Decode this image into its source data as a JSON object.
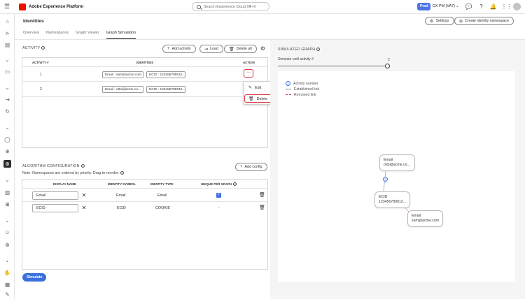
{
  "topbar": {
    "app_title": "Adobe Experience Platform",
    "search_placeholder": "Search Experience Cloud (⌘+/)",
    "org_badge": "Prod",
    "org_name": "DX PM (VA7)"
  },
  "header": {
    "title": "Identities",
    "settings_label": "Settings",
    "create_label": "Create identity namespace"
  },
  "tabs": [
    "Overview",
    "Namespaces",
    "Graph Viewer",
    "Graph Simulation"
  ],
  "activity": {
    "section_title": "ACTIVITY",
    "add_label": "Add activity",
    "load_label": "Load",
    "delete_all_label": "Delete all",
    "columns": [
      "ACTIVITY #",
      "IDENTITIES",
      "ACTION"
    ],
    "rows": [
      {
        "num": "1",
        "chip1": "Email : sam@acme.com",
        "chip2": "ECID : 123456789012..."
      },
      {
        "num": "2",
        "chip1": "Email : otto@acme.co...",
        "chip2": "ECID : 123456789012..."
      }
    ],
    "more_label": "···",
    "menu": {
      "edit": "Edit",
      "delete": "Delete"
    }
  },
  "algorithm": {
    "section_title": "ALGORITHM CONFIGURATION",
    "add_config_label": "Add config",
    "note": "Note: Namespaces are ordered by priority. Drag to reorder.",
    "columns": [
      "DISPLAY NAME",
      "IDENTITY SYMBOL",
      "IDENTITY TYPE",
      "UNIQUE PER GRAPH"
    ],
    "rows": [
      {
        "display": "Email",
        "symbol": "Email",
        "type": "Email",
        "unique": "✓"
      },
      {
        "display": "ECID",
        "symbol": "ECID",
        "type": "COOKIE",
        "unique": "-"
      }
    ],
    "simulate_label": "Simulate"
  },
  "graph": {
    "section_title": "SIMULATED GRAPH",
    "slider_label": "Simulate until activity #",
    "slider_value": "2",
    "legend": {
      "activity_number": "Activity number",
      "established": "Established link",
      "removed": "Removed link",
      "marker": "1"
    },
    "nodes": [
      {
        "line1": "Email",
        "line2": "otto@acme.co..."
      },
      {
        "line1": "ECID",
        "line2": "123456789012..."
      },
      {
        "line1": "Email",
        "line2": "sam@acme.com"
      }
    ],
    "edge_label": "2"
  },
  "colors": {
    "accent": "#3a6fe0",
    "danger": "#d7373f",
    "org_badge": "#4b75e5"
  }
}
